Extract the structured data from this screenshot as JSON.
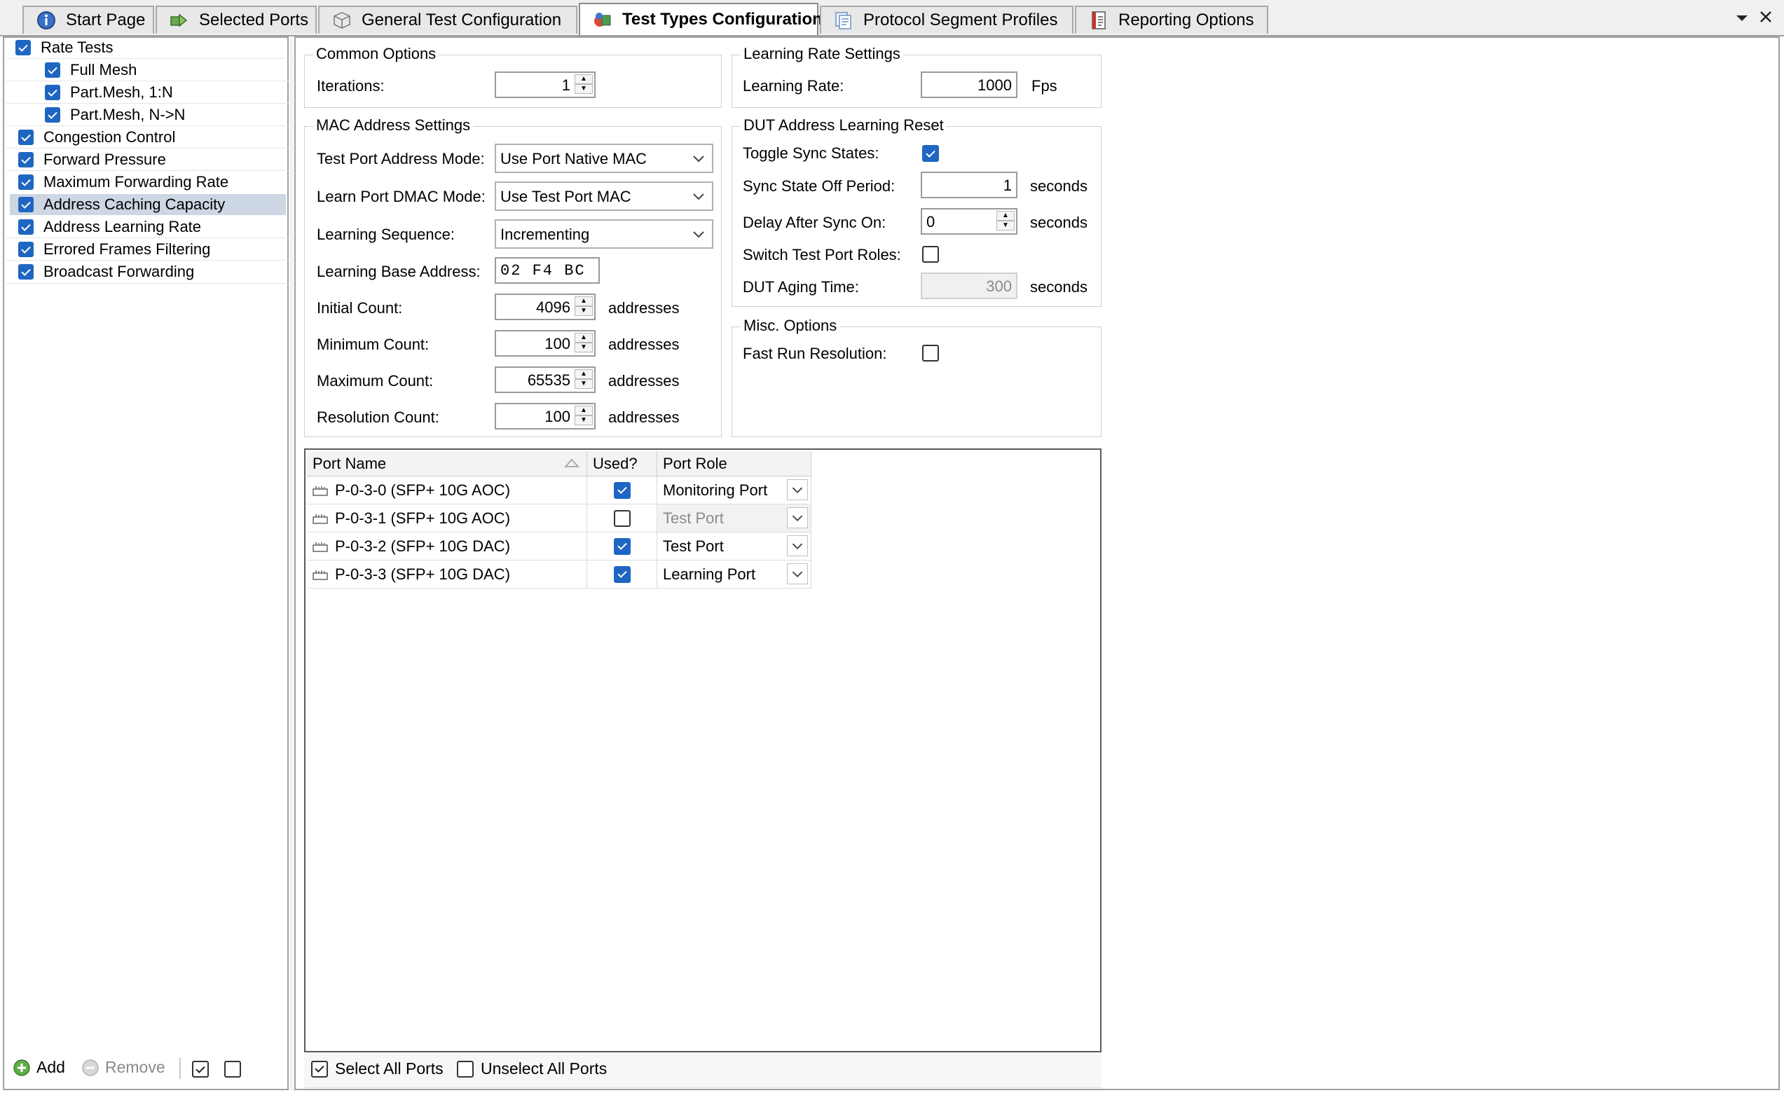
{
  "tabs": [
    {
      "label": "Start Page",
      "icon": "info-icon"
    },
    {
      "label": "Selected Ports",
      "icon": "ports-icon"
    },
    {
      "label": "General Test Configuration",
      "icon": "cube-icon"
    },
    {
      "label": "Test Types Configuration",
      "icon": "test-types-icon",
      "active": true
    },
    {
      "label": "Protocol Segment Profiles",
      "icon": "documents-icon"
    },
    {
      "label": "Reporting Options",
      "icon": "report-icon"
    }
  ],
  "tree": {
    "items": [
      {
        "label": "Rate Tests",
        "checked": true
      },
      {
        "label": "Full Mesh",
        "checked": true
      },
      {
        "label": "Part.Mesh, 1:N",
        "checked": true
      },
      {
        "label": "Part.Mesh, N->N",
        "checked": true
      },
      {
        "label": "Congestion Control",
        "checked": true
      },
      {
        "label": "Forward Pressure",
        "checked": true
      },
      {
        "label": "Maximum Forwarding Rate",
        "checked": true
      },
      {
        "label": "Address Caching Capacity",
        "checked": true,
        "selected": true
      },
      {
        "label": "Address Learning Rate",
        "checked": true
      },
      {
        "label": "Errored Frames Filtering",
        "checked": true
      },
      {
        "label": "Broadcast Forwarding",
        "checked": true
      }
    ],
    "add_label": "Add",
    "remove_label": "Remove"
  },
  "common_options": {
    "title": "Common Options",
    "iterations_label": "Iterations:",
    "iterations_value": "1"
  },
  "mac_settings": {
    "title": "MAC Address Settings",
    "test_port_mode_label": "Test Port Address Mode:",
    "test_port_mode_value": "Use Port Native MAC",
    "learn_dmac_label": "Learn Port DMAC Mode:",
    "learn_dmac_value": "Use Test Port MAC",
    "learning_seq_label": "Learning Sequence:",
    "learning_seq_value": "Incrementing",
    "base_addr_label": "Learning Base Address:",
    "base_addr_value": "02 F4 BC",
    "initial_label": "Initial Count:",
    "initial_value": "4096",
    "minimum_label": "Minimum Count:",
    "minimum_value": "100",
    "maximum_label": "Maximum Count:",
    "maximum_value": "65535",
    "resolution_label": "Resolution Count:",
    "resolution_value": "100",
    "unit": "addresses"
  },
  "learning_rate": {
    "title": "Learning Rate Settings",
    "label": "Learning Rate:",
    "value": "1000",
    "unit": "Fps"
  },
  "dut_reset": {
    "title": "DUT Address Learning Reset",
    "toggle_label": "Toggle Sync States:",
    "toggle_checked": true,
    "off_period_label": "Sync State Off Period:",
    "off_period_value": "1",
    "delay_label": "Delay After Sync On:",
    "delay_value": "0",
    "switch_label": "Switch Test Port Roles:",
    "switch_checked": false,
    "aging_label": "DUT Aging Time:",
    "aging_value": "300",
    "unit": "seconds"
  },
  "misc": {
    "title": "Misc. Options",
    "fast_run_label": "Fast Run Resolution:",
    "fast_run_checked": false
  },
  "ports_grid": {
    "headers": {
      "name": "Port Name",
      "used": "Used?",
      "role": "Port Role"
    },
    "rows": [
      {
        "name": "P-0-3-0 (SFP+ 10G AOC)",
        "used": true,
        "role": "Monitoring Port"
      },
      {
        "name": "P-0-3-1 (SFP+ 10G AOC)",
        "used": false,
        "role": "Test Port",
        "disabled": true
      },
      {
        "name": "P-0-3-2 (SFP+ 10G DAC)",
        "used": true,
        "role": "Test Port"
      },
      {
        "name": "P-0-3-3 (SFP+ 10G DAC)",
        "used": true,
        "role": "Learning Port"
      }
    ],
    "select_all_label": "Select All Ports",
    "unselect_all_label": "Unselect All Ports"
  },
  "colors": {
    "accent": "#1f66c2",
    "selection": "#cdd6e3"
  }
}
